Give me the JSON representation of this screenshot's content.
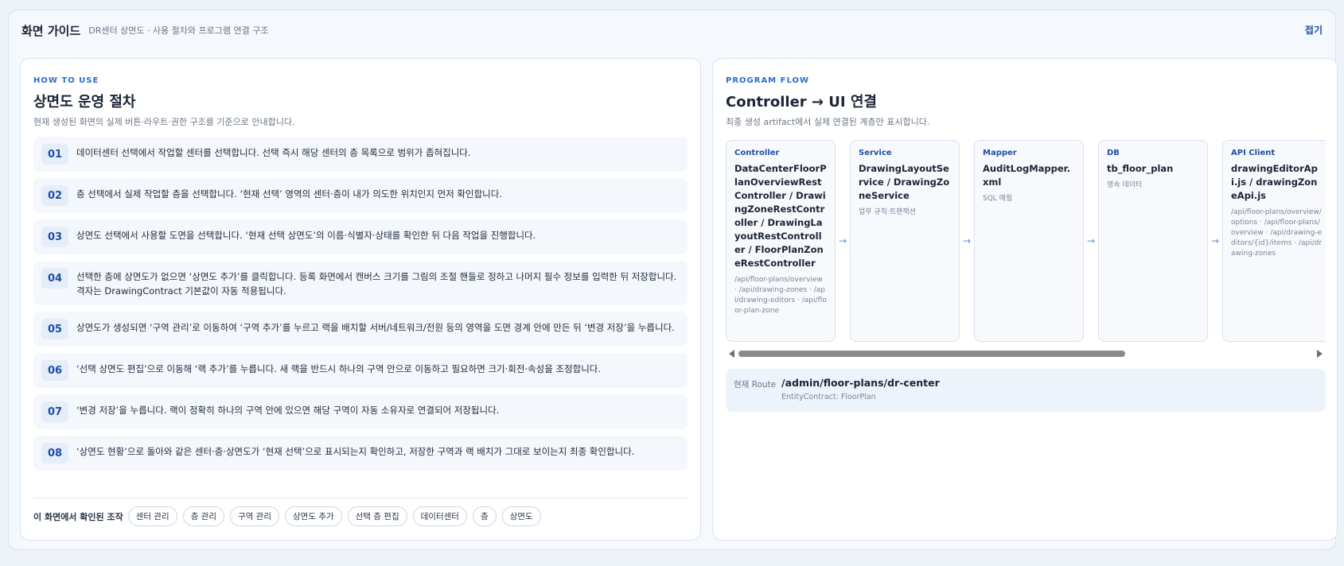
{
  "header": {
    "title": "화면 가이드",
    "subtitle": "DR센터 상면도 · 사용 절차와 프로그램 연결 구조",
    "collapse_label": "접기"
  },
  "how_to_use": {
    "eyebrow": "HOW TO USE",
    "title": "상면도 운영 절차",
    "description": "현재 생성된 화면의 실제 버튼·라우트·권한 구조를 기준으로 안내합니다.",
    "steps": [
      {
        "num": "01",
        "text": "데이터센터 선택에서 작업할 센터를 선택합니다. 선택 즉시 해당 센터의 층 목록으로 범위가 좁혀집니다."
      },
      {
        "num": "02",
        "text": "층 선택에서 실제 작업할 층을 선택합니다. ‘현재 선택’ 영역의 센터·층이 내가 의도한 위치인지 먼저 확인합니다."
      },
      {
        "num": "03",
        "text": "상면도 선택에서 사용할 도면을 선택합니다. ‘현재 선택 상면도’의 이름·식별자·상태를 확인한 뒤 다음 작업을 진행합니다."
      },
      {
        "num": "04",
        "text": "선택한 층에 상면도가 없으면 ‘상면도 추가’를 클릭합니다. 등록 화면에서 캔버스 크기를 그림의 조절 핸들로 정하고 나머지 필수 정보를 입력한 뒤 저장합니다. 격자는 DrawingContract 기본값이 자동 적용됩니다."
      },
      {
        "num": "05",
        "text": "상면도가 생성되면 ‘구역 관리’로 이동하여 ‘구역 추가’를 누르고 랙을 배치할 서버/네트워크/전원 등의 영역을 도면 경계 안에 만든 뒤 ‘변경 저장’을 누릅니다."
      },
      {
        "num": "06",
        "text": "‘선택 상면도 편집’으로 이동해 ‘랙 추가’를 누릅니다. 새 랙을 반드시 하나의 구역 안으로 이동하고 필요하면 크기·회전·속성을 조정합니다."
      },
      {
        "num": "07",
        "text": "‘변경 저장’을 누릅니다. 랙이 정확히 하나의 구역 안에 있으면 해당 구역이 자동 소유자로 연결되어 저장됩니다."
      },
      {
        "num": "08",
        "text": "‘상면도 현황’으로 돌아와 같은 센터·층·상면도가 ‘현재 선택’으로 표시되는지 확인하고, 저장한 구역과 랙 배치가 그대로 보이는지 최종 확인합니다."
      }
    ],
    "tags_label": "이 화면에서 확인된 조작",
    "tags": [
      "센터 관리",
      "층 관리",
      "구역 관리",
      "상면도 추가",
      "선택 층 편집",
      "데이터센터",
      "층",
      "상면도"
    ]
  },
  "program_flow": {
    "eyebrow": "PROGRAM FLOW",
    "title": "Controller → UI 연결",
    "description": "최종 생성 artifact에서 실제 연결된 계층만 표시합니다.",
    "cards": [
      {
        "type": "Controller",
        "name": "DataCenterFloorPlanOverviewRestController / DrawingZoneRestController / DrawingLayoutRestController / FloorPlanZoneRestController",
        "note": "/api/floor-plans/overview · /api/drawing-zones · /api/drawing-editors · /api/floor-plan-zone"
      },
      {
        "type": "Service",
        "name": "DrawingLayoutService / DrawingZoneService",
        "note": "업무 규칙·트랜잭션"
      },
      {
        "type": "Mapper",
        "name": "AuditLogMapper.xml",
        "note": "SQL 매핑"
      },
      {
        "type": "DB",
        "name": "tb_floor_plan",
        "note": "영속 데이터"
      },
      {
        "type": "API Client",
        "name": "drawingEditorApi.js / drawingZoneApi.js",
        "note": "/api/floor-plans/overview/options · /api/floor-plans/overview · /api/drawing-editors/{id}/items · /api/drawing-zones"
      }
    ],
    "arrow": "→",
    "route": {
      "label": "현재 Route",
      "value": "/admin/floor-plans/dr-center",
      "contract": "EntityContract: FloorPlan"
    }
  }
}
